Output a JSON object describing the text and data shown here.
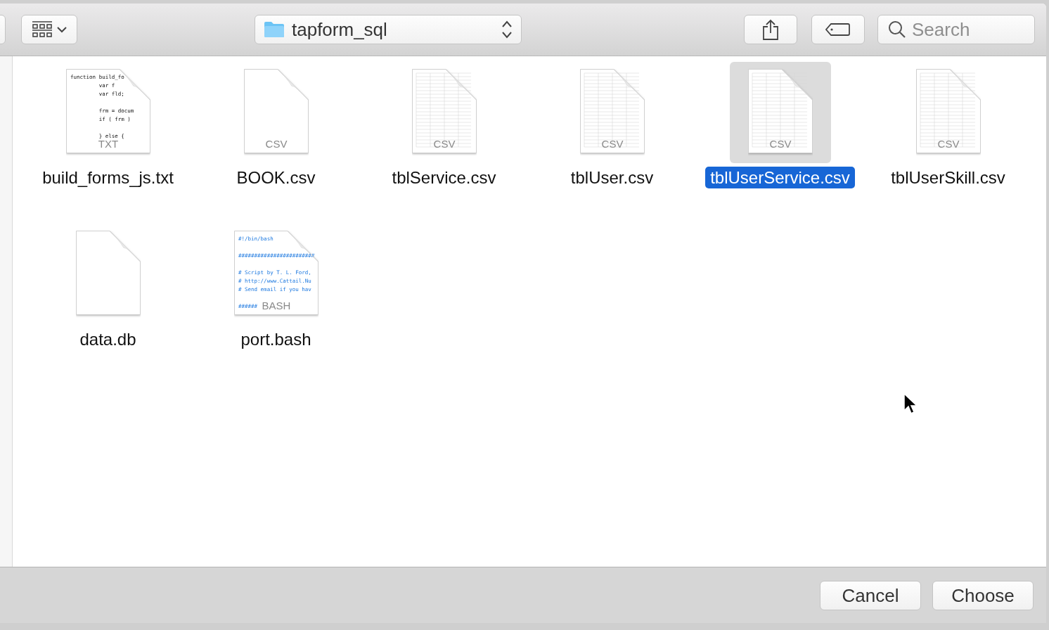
{
  "toolbar": {
    "path_popup": {
      "label": "tapform_sql"
    },
    "search": {
      "placeholder": "Search"
    }
  },
  "files": [
    {
      "name": "build_forms_js.txt",
      "type_label": "TXT",
      "kind": "code",
      "preview": "function build_fo\n         var f\n         var fld;\n\n         frm = docum\n         if ( frm )\n\n         } else {",
      "selected": false
    },
    {
      "name": "BOOK.csv",
      "type_label": "CSV",
      "kind": "blank",
      "selected": false
    },
    {
      "name": "tblService.csv",
      "type_label": "CSV",
      "kind": "table",
      "selected": false
    },
    {
      "name": "tblUser.csv",
      "type_label": "CSV",
      "kind": "table",
      "selected": false
    },
    {
      "name": "tblUserService.csv",
      "type_label": "CSV",
      "kind": "table",
      "selected": true
    },
    {
      "name": "tblUserSkill.csv",
      "type_label": "CSV",
      "kind": "table",
      "selected": false
    },
    {
      "name": "data.db",
      "kind": "blank",
      "selected": false
    },
    {
      "name": "port.bash",
      "type_label": "BASH",
      "kind": "script",
      "preview": "#!/bin/bash\n\n########################\n\n# Script by T. L. Ford,\n# http://www.Cattail.Nu\n# Send email if you hav\n\n######",
      "selected": false
    }
  ],
  "buttons": [
    {
      "label": "Cancel"
    },
    {
      "label": "Choose"
    }
  ]
}
